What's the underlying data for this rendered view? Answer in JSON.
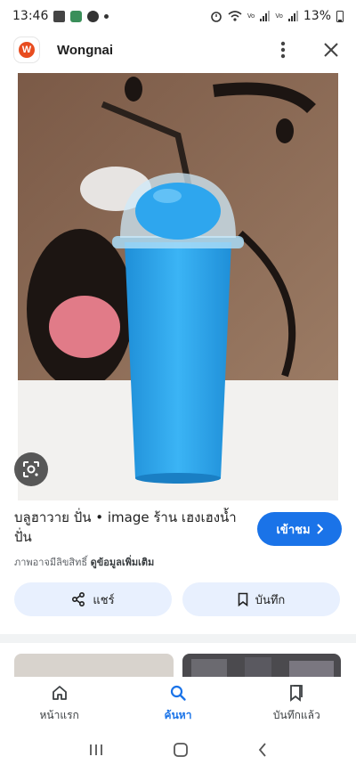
{
  "status_bar": {
    "time": "13:46",
    "battery": "13%",
    "lte1": "Vo",
    "lte2": "Vo"
  },
  "app_bar": {
    "logo_letter": "W",
    "title": "Wongnai",
    "more_icon": "more-vert-icon",
    "close_icon": "close-icon"
  },
  "image": {
    "subject": "blue slushie drink in plastic cup with dome lid and straw",
    "colors": {
      "drink": "#2aa7f0",
      "background": "#8a6a55"
    }
  },
  "result": {
    "caption": "บลูฮาวาย ปั่น • image ร้าน เฮงเฮงน้ำปั่น",
    "source_prefix": "ภาพอาจมีลิขสิทธิ์",
    "source_link": "ดูข้อมูลเพิ่มเติม",
    "visit_label": "เข้าชม"
  },
  "actions": {
    "share_label": "แชร์",
    "save_label": "บันทึก"
  },
  "bottom_nav": {
    "items": [
      {
        "label": "หน้าแรก",
        "icon": "home-icon"
      },
      {
        "label": "ค้นหา",
        "icon": "search-icon"
      },
      {
        "label": "บันทึกแล้ว",
        "icon": "saved-icon"
      }
    ],
    "active": "ค้นหา"
  },
  "theme": {
    "accent": "#1a73e8",
    "pill_bg": "#e8f0fe"
  }
}
